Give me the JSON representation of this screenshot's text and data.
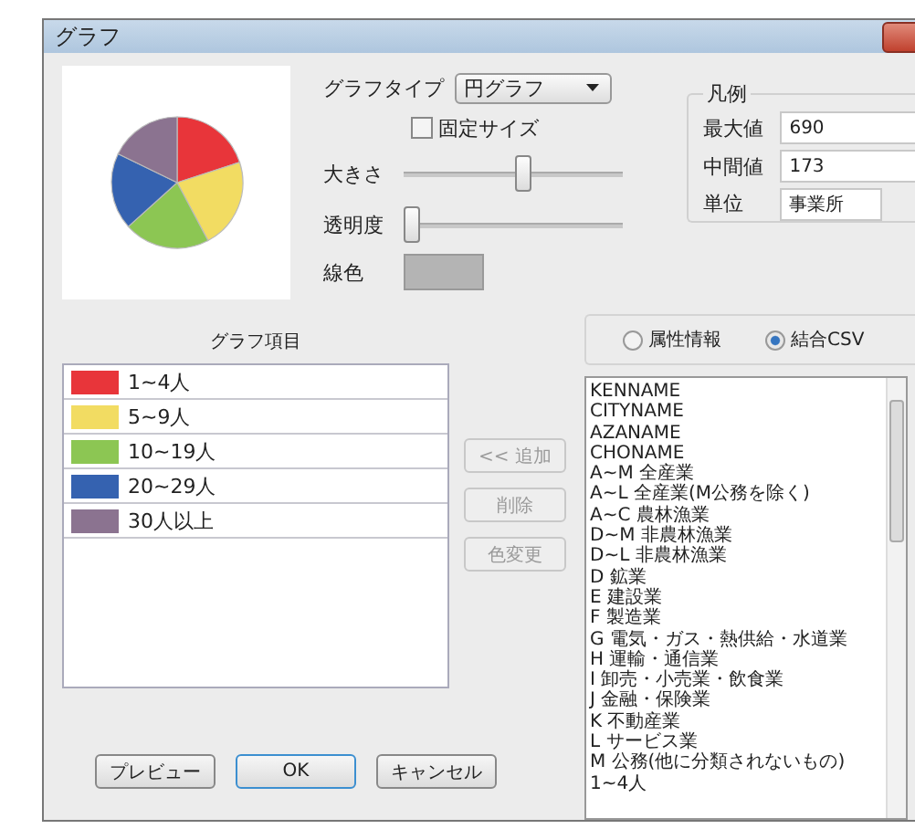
{
  "window": {
    "title": "グラフ"
  },
  "graph_type": {
    "label": "グラフタイプ",
    "value": "円グラフ"
  },
  "fixed_size": {
    "label": "固定サイズ",
    "checked": false
  },
  "sliders": [
    {
      "label": "大きさ",
      "level": 0.54
    },
    {
      "label": "透明度",
      "level": 0
    }
  ],
  "line_color": {
    "label": "線色"
  },
  "legend": {
    "title": "凡例",
    "fields": [
      {
        "label": "最大値",
        "value": "690"
      },
      {
        "label": "中間値",
        "value": "173"
      },
      {
        "label": "単位",
        "value": "事業所"
      }
    ]
  },
  "source_options": [
    {
      "label": "属性情報",
      "selected": false
    },
    {
      "label": "結合CSV",
      "selected": true
    }
  ],
  "graph_items": {
    "title": "グラフ項目",
    "items": [
      {
        "label": "1~4人",
        "color": "#e8353a"
      },
      {
        "label": "5~9人",
        "color": "#f2dc62"
      },
      {
        "label": "10~19人",
        "color": "#8cc653"
      },
      {
        "label": "20~29人",
        "color": "#3562b0"
      },
      {
        "label": "30人以上",
        "color": "#8b7390"
      }
    ]
  },
  "side_buttons": [
    {
      "label": "<< 追加",
      "disabled": true
    },
    {
      "label": "削除",
      "disabled": true
    },
    {
      "label": "色変更",
      "disabled": true
    }
  ],
  "field_list": [
    "KENNAME",
    "CITYNAME",
    "AZANAME",
    "CHONAME",
    "A~M 全産業",
    "A~L 全産業(M公務を除く)",
    "A~C 農林漁業",
    "D~M 非農林漁業",
    "D~L 非農林漁業",
    "D 鉱業",
    "E 建設業",
    "F 製造業",
    "G 電気・ガス・熱供給・水道業",
    "H 運輸・通信業",
    "I 卸売・小売業・飲食業",
    "J 金融・保険業",
    "K 不動産業",
    "L サービス業",
    "M 公務(他に分類されないもの)",
    "1~4人"
  ],
  "buttons": [
    {
      "label": "プレビュー",
      "default": false
    },
    {
      "label": "OK",
      "default": true
    },
    {
      "label": "キャンセル",
      "default": false
    }
  ]
}
